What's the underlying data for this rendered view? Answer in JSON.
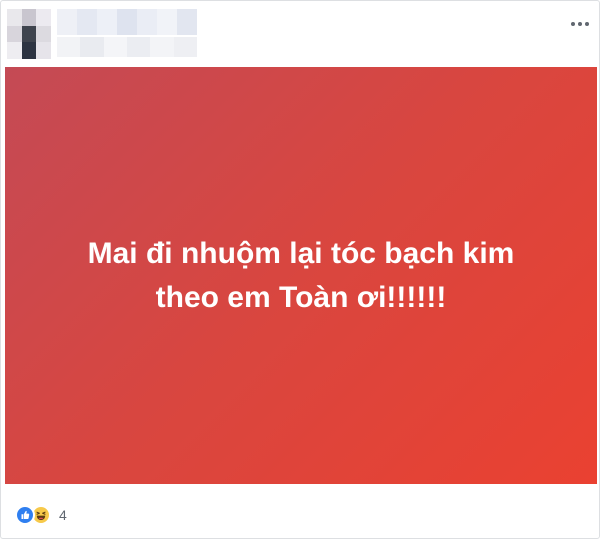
{
  "post": {
    "status_text_line1": "Mai đi nhuộm lại tóc bạch kim",
    "status_text_line2": "theo em Toàn ơi!!!!!!",
    "banner_gradient": [
      "#c44a55",
      "#ea4131"
    ]
  },
  "reactions": {
    "types": [
      "like-icon",
      "haha-icon"
    ],
    "count": "4"
  },
  "header": {
    "menu_icon": "more-horizontal-icon"
  }
}
